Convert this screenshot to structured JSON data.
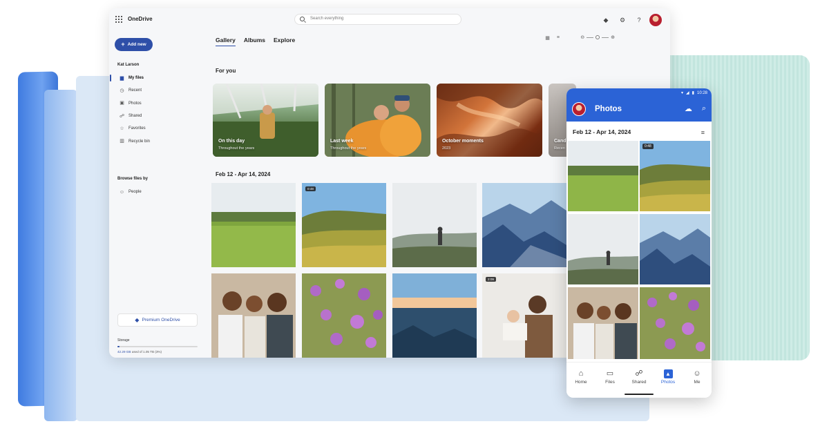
{
  "app": {
    "title": "OneDrive"
  },
  "search": {
    "placeholder": "Search everything"
  },
  "sidebar": {
    "add_label": "Add new",
    "user": "Kat Larson",
    "items": [
      {
        "label": "My files",
        "icon": "folder-icon"
      },
      {
        "label": "Recent",
        "icon": "clock-icon"
      },
      {
        "label": "Photos",
        "icon": "photo-icon"
      },
      {
        "label": "Shared",
        "icon": "people-icon"
      },
      {
        "label": "Favorites",
        "icon": "star-icon"
      },
      {
        "label": "Recycle bin",
        "icon": "trash-icon"
      }
    ],
    "browse_title": "Browse files by",
    "people_label": "People",
    "premium_label": "Premium OneDrive",
    "storage_label": "Storage",
    "storage_used": "42.29 GB",
    "storage_rest": " used of 1.05 TB (3%)",
    "storage_fraction": 0.03
  },
  "main": {
    "tabs": [
      {
        "label": "Gallery",
        "active": true
      },
      {
        "label": "Albums",
        "active": false
      },
      {
        "label": "Explore",
        "active": false
      }
    ],
    "for_you_title": "For you",
    "cards": [
      {
        "title": "On this day",
        "sub": "Throughout the years"
      },
      {
        "title": "Last week",
        "sub": "Throughout the years"
      },
      {
        "title": "October moments",
        "sub": "2023"
      },
      {
        "title": "Cand",
        "sub": "Recen"
      }
    ],
    "date_range": "Feb 12 - Apr 14, 2024",
    "badges": {
      "video1": "0:48",
      "video2": "2:09"
    }
  },
  "phone": {
    "time": "10:28",
    "title": "Photos",
    "date_range": "Feb 12 - Apr 14, 2024",
    "badge": "0:48",
    "nav": [
      {
        "label": "Home",
        "active": false
      },
      {
        "label": "Files",
        "active": false
      },
      {
        "label": "Shared",
        "active": false
      },
      {
        "label": "Photos",
        "active": true
      },
      {
        "label": "Me",
        "active": false
      }
    ]
  },
  "colors": {
    "accent": "#2e4fa8",
    "phone_header": "#2b63d6"
  }
}
